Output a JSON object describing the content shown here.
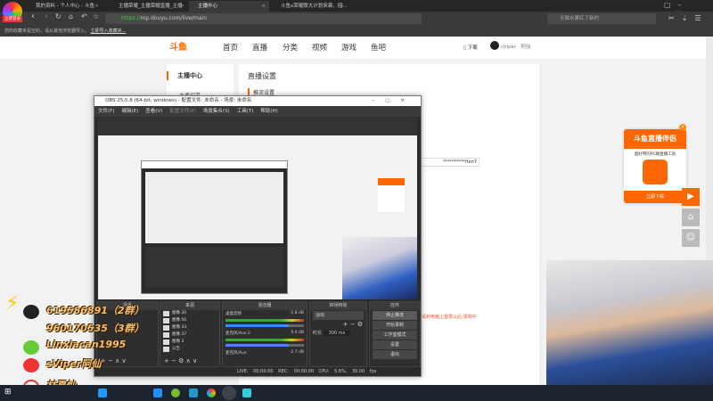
{
  "browser": {
    "badge": "立即登录",
    "tabs": [
      {
        "label": "我的资料 - 个人中心 - 斗鱼"
      },
      {
        "label": "主播荣耀_主播荣耀直播_主播"
      },
      {
        "label": "主播中心"
      },
      {
        "label": "斗鱼x荣耀联大计划来袭，招..."
      }
    ],
    "url_scheme": "https://",
    "url_rest": "mp.douyu.com/live/main",
    "search_placeholder": "天猫水果红了新的",
    "bookmark_text": "您的收藏夹是空的，请从其他浏览器导入。",
    "bookmark_link": "立即导入收藏夹..."
  },
  "site": {
    "logo": "斗鱼",
    "nav": [
      "首页",
      "直播",
      "分类",
      "视频",
      "游戏",
      "鱼吧"
    ],
    "download": "下载",
    "user": "sViper · 阿仙",
    "sidebar_title": "主播中心",
    "sidebar_item": "主播招募",
    "page_title": "直播设置",
    "section": "推流设置",
    "key_field": "**********ften7",
    "status_text": "请到电脑上登录以后    录制中"
  },
  "obs": {
    "title": "OBS 25.0.8 (64-bit, windows) - 配置文件: 未命名 - 场景: 未命名",
    "menu": [
      "文件(F)",
      "编辑(E)",
      "查看(V)",
      "配置文件(P)",
      "场景集合(S)",
      "工具(T)",
      "帮助(H)"
    ],
    "docks": {
      "scenes": "场景",
      "sources": "来源",
      "mixer": "混音器",
      "transitions": "转场特效",
      "controls": "控件"
    },
    "sources": [
      "图像 20",
      "图像 56",
      "图像 33",
      "图像 37",
      "图像 3",
      "公告"
    ],
    "mixer": [
      {
        "name": "桌面音频",
        "db": "-1.8 dB"
      },
      {
        "name": "麦克风/Aux 2",
        "db": "0.0 dB"
      },
      {
        "name": "麦克风/Aux",
        "db": "-2.7 dB"
      }
    ],
    "transition": "淡出",
    "duration_label": "时长",
    "duration": "300 ms",
    "controls": [
      "停止推流",
      "开始录制",
      "工作室模式",
      "设置",
      "退出"
    ],
    "status": {
      "live": "LIVE: 00:00:00",
      "rec": "REC: 00:00:00",
      "cpu": "CPU: 5.6%, 30.00 fps"
    }
  },
  "ad": {
    "title": "斗鱼直播伴侣",
    "subtitle": "超好用的PC端直播工具",
    "button": "立即下载"
  },
  "overlay": [
    "619586891（2群）",
    "960170535（3群）",
    "Linxiacan1995",
    "sViper阿仙",
    "林夏灿"
  ]
}
